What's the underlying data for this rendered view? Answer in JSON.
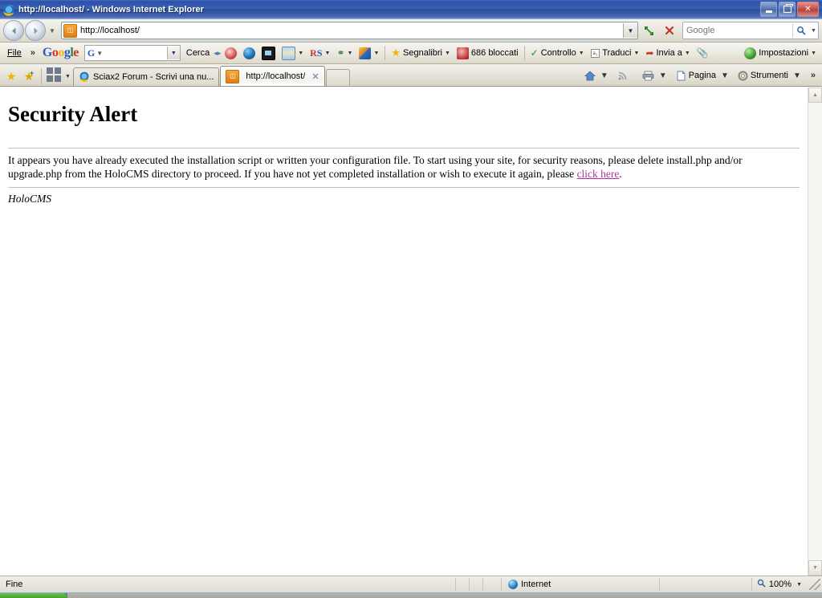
{
  "window": {
    "title": "http://localhost/ - Windows Internet Explorer",
    "app_icon": "internet-explorer-icon",
    "minimize_label": "",
    "restore_label": "",
    "close_label": "✕"
  },
  "navbar": {
    "back_label": "◄",
    "forward_label": "►",
    "history_dropdown_label": "▼",
    "address_favicon": "◫",
    "address_value": "http://localhost/",
    "address_dropdown_label": "▼",
    "refresh_label": "↻",
    "stop_label": "✕",
    "search_placeholder": "Google",
    "search_value": "",
    "search_go_label": "🔍",
    "search_dropdown_label": "▼"
  },
  "google_toolbar": {
    "file_menu": "File",
    "overflow_chevron": "»",
    "logo": {
      "g1": "G",
      "o1": "o",
      "o2": "o",
      "g2": "g",
      "l": "l",
      "e": "e"
    },
    "search_box": {
      "prefix_icon": "G",
      "value": "",
      "caret": "▼",
      "dropdown_label": "▼"
    },
    "search_label": "Cerca",
    "items": [
      {
        "name": "popup-blocker",
        "label": "",
        "arrow": ""
      },
      {
        "name": "globe-earth",
        "label": "",
        "arrow": ""
      },
      {
        "name": "photos",
        "label": "",
        "arrow": ""
      },
      {
        "name": "maps",
        "label": "",
        "arrow": "▼"
      },
      {
        "name": "rs-button",
        "label": "RS",
        "arrow": "▼"
      },
      {
        "name": "links",
        "label": "",
        "arrow": "▼"
      },
      {
        "name": "highlight",
        "label": "",
        "arrow": "▼"
      }
    ],
    "bookmarks_label": "Segnalibri",
    "bookmarks_arrow": "▼",
    "blocked_label": "686 bloccati",
    "spellcheck_label": "Controllo",
    "spellcheck_arrow": "▼",
    "translate_label": "Traduci",
    "translate_icon_text": "a₃",
    "translate_arrow": "▼",
    "sendto_label": "Invia a",
    "sendto_arrow": "▼",
    "clip_label": "",
    "settings_label": "Impostazioni",
    "settings_arrow": "▼"
  },
  "tabbar": {
    "favorites_icon": "★",
    "add_favorites_icon": "★",
    "quicktabs_dropdown": "▼",
    "tabs": [
      {
        "title": "Sciax2 Forum - Scrivi una nu...",
        "favicon": "internet-explorer-icon",
        "active": false,
        "close": ""
      },
      {
        "title": "http://localhost/",
        "favicon": "page-favicon",
        "active": true,
        "close": "✕"
      }
    ],
    "new_tab_label": "",
    "right_items": [
      {
        "name": "home",
        "label": "",
        "arrow": "▼"
      },
      {
        "name": "feeds",
        "label": "",
        "arrow": ""
      },
      {
        "name": "print",
        "label": "",
        "arrow": "▼"
      },
      {
        "name": "page",
        "label": "Pagina",
        "arrow": "▼"
      },
      {
        "name": "tools",
        "label": "Strumenti",
        "arrow": "▼"
      }
    ],
    "overflow_chevron": "»"
  },
  "page_content": {
    "heading": "Security Alert",
    "paragraph_part1": "It appears you have already executed the installation script or written your configuration file. To start using your site, for security reasons, please delete install.php and/or upgrade.php from the HoloCMS directory to proceed. If you have not yet completed installation or wish to execute it again, please ",
    "link_text": "click here",
    "paragraph_part2": ".",
    "signature": "HoloCMS",
    "link_color": "#b0339b"
  },
  "scrollbar": {
    "up_arrow": "▲",
    "down_arrow": "▼"
  },
  "statusbar": {
    "status_text": "Fine",
    "zone_label": "Internet",
    "zone_icon": "globe-icon",
    "zoom_level": "100%",
    "zoom_icon": "magnifier-icon",
    "zoom_dropdown": "▼"
  },
  "taskbar": {
    "start_label": ""
  }
}
